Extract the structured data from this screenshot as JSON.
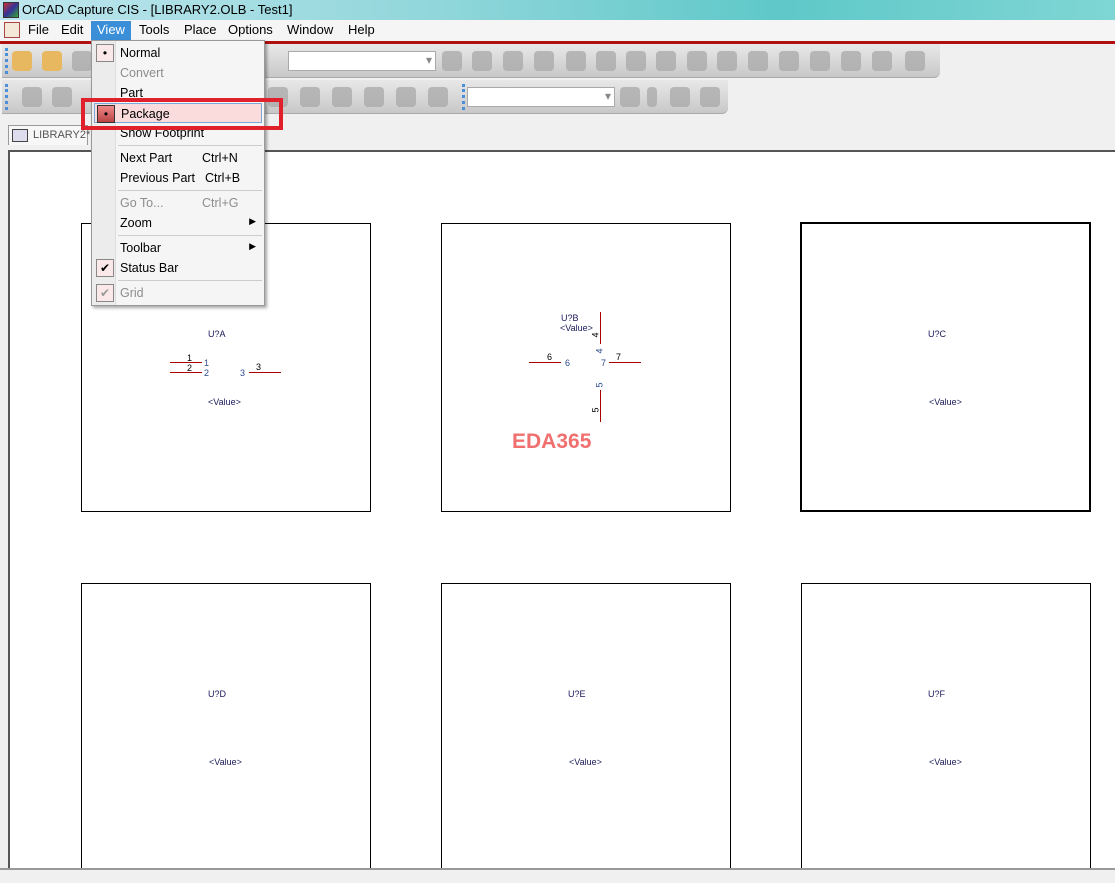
{
  "window": {
    "title": "OrCAD Capture CIS - [LIBRARY2.OLB - Test1]"
  },
  "menubar": [
    {
      "label": "File"
    },
    {
      "label": "Edit"
    },
    {
      "label": "View"
    },
    {
      "label": "Tools"
    },
    {
      "label": "Place"
    },
    {
      "label": "Options"
    },
    {
      "label": "Window"
    },
    {
      "label": "Help"
    }
  ],
  "toolbar1": {
    "icons": [
      "new-file-icon",
      "open-folder-icon",
      "save-icon",
      "zoom-in-icon",
      "zoom-out-icon",
      "zoom-area-icon",
      "zoom-all-icon",
      "eye-icon",
      "part-reference-icon",
      "annotate-icon",
      "back-annotate-icon",
      "drc-icon",
      "netlist-icon",
      "cross-reference-icon",
      "bom-icon",
      "snap-grid-icon",
      "area-select-icon",
      "drag-icon",
      "hierarchy-icon",
      "help-icon"
    ],
    "dropdown_value": ""
  },
  "toolbar2": {
    "icons": [
      "place-pin-icon",
      "place-pin-array-icon",
      "ieee-symbol-icon",
      "power-icon",
      "ground-icon",
      "no-connect-icon",
      "wire-icon",
      "bus-icon",
      "find-icon",
      "find-dropdown-icon",
      "previous-icon",
      "next-icon"
    ],
    "dropdown_value": ""
  },
  "tab": {
    "label": "LIBRARY2*"
  },
  "view_menu": {
    "items": [
      {
        "label": "Normal",
        "checked": "•",
        "disabled": false
      },
      {
        "label": "Convert",
        "disabled": true
      },
      {
        "label": "Part",
        "disabled": false
      },
      {
        "label": "Package",
        "checked": "•",
        "highlighted": true
      },
      {
        "label": "Show Footprint"
      },
      {
        "label": "Next Part",
        "shortcut": "Ctrl+N"
      },
      {
        "label": "Previous Part",
        "shortcut": "Ctrl+B"
      },
      {
        "label": "Go To...",
        "shortcut": "Ctrl+G",
        "disabled": true
      },
      {
        "label": "Zoom",
        "submenu": "▶"
      },
      {
        "label": "Toolbar",
        "submenu": "▶"
      },
      {
        "label": "Status Bar",
        "checked": "✔"
      },
      {
        "label": "Grid",
        "checked": "✔",
        "disabled": true
      }
    ]
  },
  "parts": [
    {
      "ref": "U?A",
      "value": "<Value>",
      "pins": [
        "1",
        "1",
        "2",
        "2",
        "3",
        "3"
      ]
    },
    {
      "ref": "U?B",
      "value": "<Value>",
      "pins": [
        "4",
        "4",
        "6",
        "6",
        "7",
        "7",
        "5",
        "5"
      ]
    },
    {
      "ref": "U?C",
      "value": "<Value>"
    },
    {
      "ref": "U?D",
      "value": "<Value>"
    },
    {
      "ref": "U?E",
      "value": "<Value>"
    },
    {
      "ref": "U?F",
      "value": "<Value>"
    }
  ],
  "watermark": "EDA365",
  "colors": {
    "highlight_box": "#e0202a",
    "pin": "#aa0000",
    "menu_active": "#3a8fd8"
  }
}
